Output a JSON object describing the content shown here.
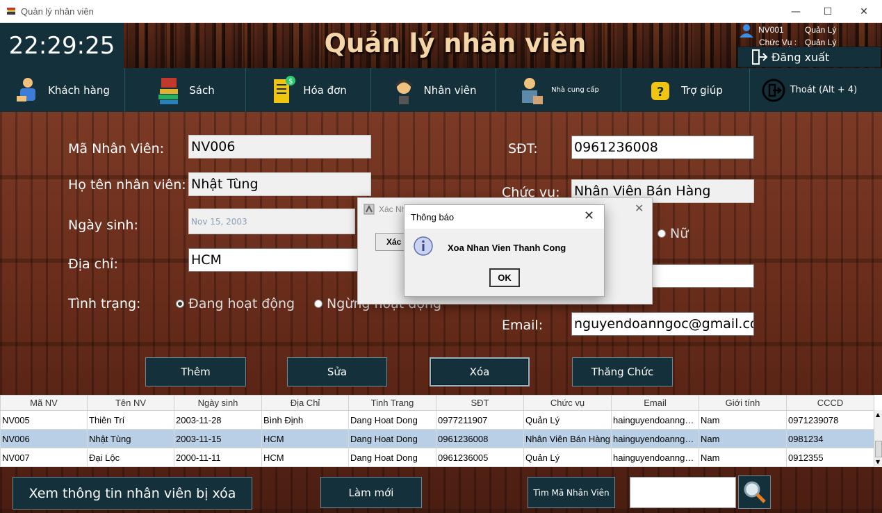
{
  "window": {
    "title": "Quản lý nhân viên",
    "minimize": "—",
    "maximize": "☐",
    "close": "✕"
  },
  "header": {
    "clock": "22:29:25",
    "title": "Quản lý nhân viên",
    "user_id": "NV001",
    "user_role": "Quản Lý",
    "title_label": "Chức Vụ :",
    "title_value": "Quản Lý",
    "logout": "Đăng xuất"
  },
  "nav": [
    {
      "label": "Khách hàng",
      "icon": "customer-icon"
    },
    {
      "label": "Sách",
      "icon": "books-icon"
    },
    {
      "label": "Hóa đơn",
      "icon": "invoice-icon"
    },
    {
      "label": "Nhân viên",
      "icon": "employee-icon"
    },
    {
      "label": "Nhà cung cấp",
      "icon": "supplier-icon"
    },
    {
      "label": "Trợ giúp",
      "icon": "help-icon"
    },
    {
      "label": "Thoát (Alt + 4)",
      "icon": "exit-icon"
    }
  ],
  "form": {
    "ma_nv_label": "Mã Nhân Viên:",
    "ma_nv": "NV006",
    "ho_ten_label": "Họ tên nhân viên:",
    "ho_ten": "Nhật Tùng",
    "ngay_sinh_label": "Ngày sinh:",
    "ngay_sinh": "Nov 15, 2003",
    "dia_chi_label": "Địa chỉ:",
    "dia_chi": "HCM",
    "tinh_trang_label": "Tình trạng:",
    "status_active": "Đang hoạt động",
    "status_inactive": "Ngừng hoạt động",
    "sdt_label": "SĐT:",
    "sdt": "0961236008",
    "chuc_vu_label": "Chức vụ:",
    "chuc_vu": "Nhân Viên Bán Hàng",
    "gender_female": "Nữ",
    "email_label": "Email:",
    "email": "nguyendoanngoc@gmail.com"
  },
  "buttons": {
    "add": "Thêm",
    "edit": "Sửa",
    "delete": "Xóa",
    "promote": "Thăng Chức",
    "view_deleted": "Xem thông tin nhân viên bị xóa",
    "refresh": "Làm mới",
    "search_by_id": "Tìm Mã Nhân Viên"
  },
  "table": {
    "columns": [
      "Mã NV",
      "Tên NV",
      "Ngày sinh",
      "Địa Chỉ",
      "Tinh Trang",
      "SĐT",
      "Chức vụ",
      "Email",
      "Giới tính",
      "CCCD"
    ],
    "rows": [
      [
        "NV005",
        "Thiên Trí",
        "2003-11-28",
        "Bình Định",
        "Dang Hoat Dong",
        "0977211907",
        "Quản Lý",
        "hainguyendoanngoc...",
        "Nam",
        "0971239078"
      ],
      [
        "NV006",
        "Nhật Tùng",
        "2003-11-15",
        "HCM",
        "Dang Hoat Dong",
        "0961236008",
        "Nhân Viên Bán Hàng",
        "hainguyendoanngoc...",
        "Nam",
        "0981234"
      ],
      [
        "NV007",
        "Đại Lộc",
        "2000-11-11",
        "HCM",
        "Dang Hoat Dong",
        "0961236005",
        "Quản Lý",
        "hainguyendoanngoc...",
        "Nam",
        "0912355"
      ]
    ],
    "selected_index": 1
  },
  "dialog_back": {
    "title": "Xác Nhận Xóa Nhân Viên",
    "button": "Xác",
    "close": "✕"
  },
  "dialog": {
    "title": "Thông báo",
    "message": "Xoa Nhan Vien Thanh Cong",
    "ok": "OK",
    "close": "✕"
  },
  "colors": {
    "nav_bg": "#14313b",
    "heading": "#f4d6a8",
    "selected_row": "#b8cfe5"
  }
}
